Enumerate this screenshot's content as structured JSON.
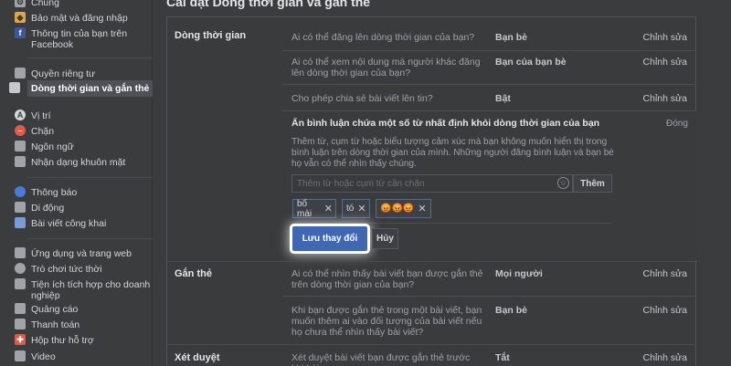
{
  "sidebar": {
    "items": [
      {
        "label": "Chung",
        "icon": "gear-icon",
        "color": "#a0a3a8",
        "glyph": "⚙"
      },
      {
        "label": "Bảo mật và đăng nhập",
        "icon": "shield-icon",
        "color": "#e0a64a",
        "glyph": "◆"
      },
      {
        "label": "Thông tin của bạn trên Facebook",
        "icon": "facebook-icon",
        "color": "#3b5998",
        "glyph": "f"
      },
      {
        "label": "Quyền riêng tư",
        "icon": "privacy-lock-icon",
        "color": "#a0a3a8",
        "glyph": "🔒"
      },
      {
        "label": "Dòng thời gian và gắn thẻ",
        "icon": "timeline-icon",
        "color": "#c5c8cd",
        "glyph": "▤"
      },
      {
        "label": "Vị trí",
        "icon": "location-icon",
        "color": "#d4d6da",
        "glyph": "A"
      },
      {
        "label": "Chặn",
        "icon": "block-icon",
        "color": "#e05a4a",
        "glyph": "–"
      },
      {
        "label": "Ngôn ngữ",
        "icon": "language-icon",
        "color": "#a0a3a8",
        "glyph": "文"
      },
      {
        "label": "Nhận dạng khuôn mặt",
        "icon": "face-recognition-icon",
        "color": "#a0a3a8",
        "glyph": "☺"
      },
      {
        "label": "Thông báo",
        "icon": "globe-icon",
        "color": "#4a7ad8",
        "glyph": "●"
      },
      {
        "label": "Di động",
        "icon": "mobile-icon",
        "color": "#a0a3a8",
        "glyph": "▯"
      },
      {
        "label": "Bài viết công khai",
        "icon": "rss-icon",
        "color": "#7a9ad8",
        "glyph": "▦"
      },
      {
        "label": "Ứng dụng và trang web",
        "icon": "apps-icon",
        "color": "#a0a3a8",
        "glyph": "✕"
      },
      {
        "label": "Trò chơi tức thời",
        "icon": "game-icon",
        "color": "#a0a3a8",
        "glyph": "◉"
      },
      {
        "label": "Tiện ích tích hợp cho doanh nghiệp",
        "icon": "business-integration-icon",
        "color": "#a0a3a8",
        "glyph": "▣"
      },
      {
        "label": "Quảng cáo",
        "icon": "ads-icon",
        "color": "#a0a3a8",
        "glyph": "▭"
      },
      {
        "label": "Thanh toán",
        "icon": "payment-icon",
        "color": "#a0a3a8",
        "glyph": "▬"
      },
      {
        "label": "Hộp thư hỗ trợ",
        "icon": "support-inbox-icon",
        "color": "#e05a4a",
        "glyph": "✚"
      },
      {
        "label": "Video",
        "icon": "video-icon",
        "color": "#a0a3a8",
        "glyph": "▶"
      }
    ]
  },
  "page_title": "Cài đặt Dòng thời gian và gắn thẻ",
  "sections": {
    "timeline": {
      "label": "Dòng thời gian",
      "rows": [
        {
          "question": "Ai có thể đăng lên dòng thời gian của bạn?",
          "value": "Bạn bè",
          "edit": "Chỉnh sửa"
        },
        {
          "question": "Ai có thể xem nội dung mà người khác đăng lên dòng thời gian của bạn?",
          "value": "Bạn của bạn bè",
          "edit": "Chỉnh sửa"
        },
        {
          "question": "Cho phép chia sẻ bài viết lên tin?",
          "value": "Bật",
          "edit": "Chỉnh sửa"
        }
      ]
    },
    "hide_comments": {
      "title": "Ẩn bình luận chứa một số từ nhất định khỏi dòng thời gian của bạn",
      "close": "Đóng",
      "description": "Thêm từ, cụm từ hoặc biểu tượng cảm xúc mà bạn không muốn hiển thị trong bình luận trên dòng thời gian của mình. Những người đăng bình luận và bạn bè họ vẫn có thể nhìn thấy chúng.",
      "search_placeholder": "Thêm từ hoặc cụm từ cần chặn",
      "add_label": "Thêm",
      "chips": [
        "bố mài",
        "tó",
        "😡😡😡"
      ],
      "save_label": "Lưu thay đổi",
      "cancel_label": "Hủy"
    },
    "tagging": {
      "label": "Gắn thẻ",
      "rows": [
        {
          "question": "Ai có thể nhìn thấy bài viết bạn được gắn thẻ trên dòng thời gian của bạn?",
          "value": "Mọi người",
          "edit": "Chỉnh sửa"
        },
        {
          "question": "Khi bạn được gắn thẻ trong một bài viết, bạn muốn thêm ai vào đối tượng của bài viết nếu họ chưa thể nhìn thấy bài viết?",
          "value": "Bạn bè",
          "edit": "Chỉnh sửa"
        }
      ]
    },
    "review": {
      "label": "Xét duyệt",
      "rows": [
        {
          "question": "Xét duyệt bài viết bạn được gắn thẻ trước khi bài",
          "value": "Tắt",
          "edit": "Chỉnh sửa"
        }
      ]
    }
  }
}
